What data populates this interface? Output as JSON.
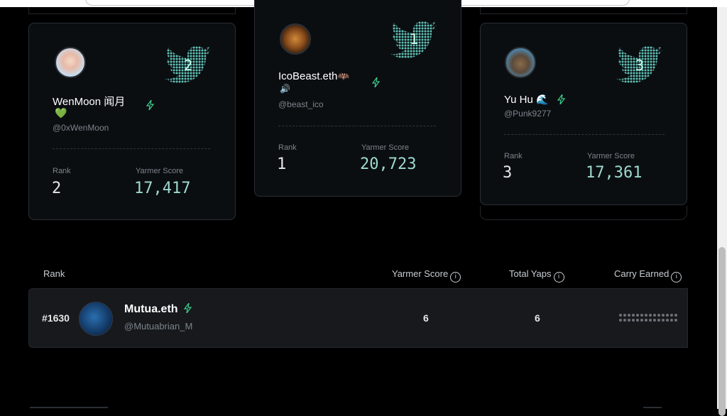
{
  "cards": [
    {
      "position": "2",
      "name": "WenMoon 闻月",
      "name_emoji": "💚",
      "handle": "@0xWenMoon",
      "rank_label": "Rank",
      "rank": "2",
      "score_label": "Yarmer Score",
      "score": "17,417"
    },
    {
      "position": "1",
      "name": "IcoBeast.eth",
      "name_emoji": "🦇",
      "name_emoji2": "🔊",
      "handle": "@beast_ico",
      "rank_label": "Rank",
      "rank": "1",
      "score_label": "Yarmer Score",
      "score": "20,723"
    },
    {
      "position": "3",
      "name": "Yu Hu",
      "name_emoji": "🌊",
      "handle": "@Punk9277",
      "rank_label": "Rank",
      "rank": "3",
      "score_label": "Yarmer Score",
      "score": "17,361"
    }
  ],
  "table": {
    "headers": {
      "rank": "Rank",
      "score": "Yarmer Score",
      "yaps": "Total Yaps",
      "carry": "Carry Earned"
    },
    "info_glyph": "i",
    "rows": [
      {
        "rank": "#1630",
        "name": "Mutua.eth",
        "handle": "@Mutuabrian_M",
        "score": "6",
        "yaps": "6",
        "carry": "hidden"
      }
    ]
  },
  "colors": {
    "accent_bolt": "#3ecf8e",
    "score_text": "#9ed9d0",
    "bird": "#5fc2b6"
  },
  "icons": [
    "bolt-icon",
    "twitter-bird-badge-icon",
    "info-icon"
  ]
}
